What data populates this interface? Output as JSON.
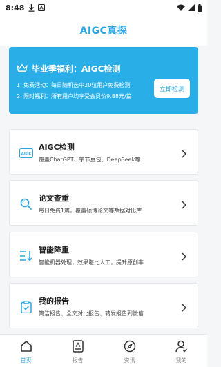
{
  "status_bar": {
    "time": "8:48",
    "icons": [
      "download-icon",
      "notification-a-icon",
      "wifi-icon",
      "signal-icon",
      "battery-icon"
    ]
  },
  "app": {
    "title": "AIGC真探"
  },
  "promo": {
    "title": "毕业季福利：AIGC检测",
    "line1": "1. 免费活动：每日随机选中20位用户免费检测",
    "line2": "2. 限时福利：所有用户均享受会员价9.88元/篇",
    "button": "立即检测",
    "icon": "crown-icon"
  },
  "features": [
    {
      "icon": "aigc-badge-icon",
      "icon_text": "AIGC",
      "title": "AIGC检测",
      "desc": "覆盖ChatGPT、字节豆包、DeepSeek等"
    },
    {
      "icon": "search-doc-icon",
      "title": "论文查重",
      "desc": "每日免费1篇，覆盖硕博论文等数据对比库"
    },
    {
      "icon": "sort-down-icon",
      "title": "智能降重",
      "desc": "智能机器处理，效果堪比人工，提升原创率"
    },
    {
      "icon": "clipboard-check-icon",
      "title": "我的报告",
      "desc": "简洁报告、全文对比报告、转发报告到微信"
    }
  ],
  "bottom_nav": [
    {
      "icon": "home-icon",
      "label": "首页",
      "active": true
    },
    {
      "icon": "report-icon",
      "label": "报告",
      "active": false
    },
    {
      "icon": "compass-icon",
      "label": "资讯",
      "active": false
    },
    {
      "icon": "user-icon",
      "label": "我的",
      "active": false
    }
  ],
  "colors": {
    "accent": "#2aa5e0",
    "banner": "#2aaee8",
    "background": "#f5f6f8"
  }
}
